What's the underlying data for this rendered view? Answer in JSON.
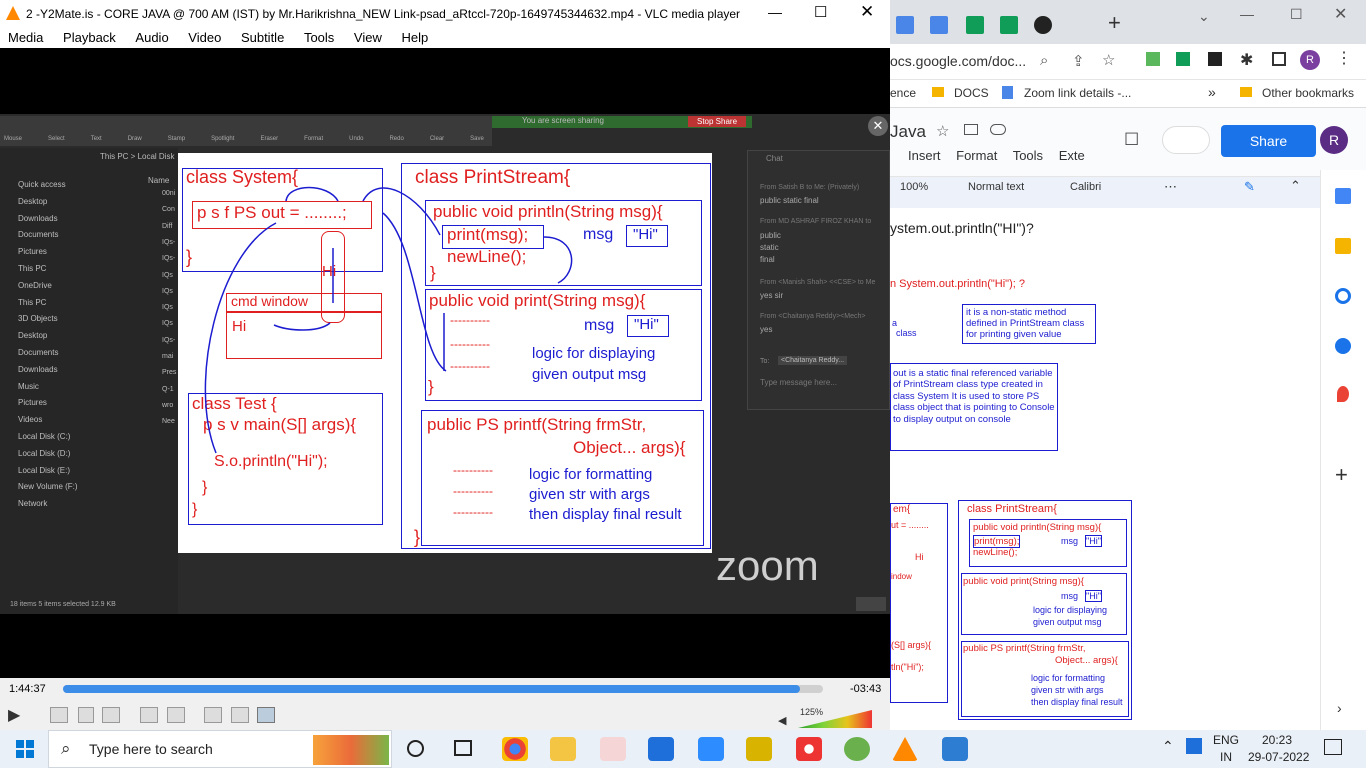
{
  "vlc": {
    "title": "2 -Y2Mate.is - CORE JAVA @ 700 AM (IST) by Mr.Harikrishna_NEW Link-psad_aRtccl-720p-1649745344632.mp4 - VLC media player",
    "menu": [
      "Media",
      "Playback",
      "Audio",
      "Video",
      "Subtitle",
      "Tools",
      "View",
      "Help"
    ],
    "time_elapsed": "1:44:37",
    "time_remaining": "-03:43",
    "progress": 0.97,
    "volume": "125%"
  },
  "zoom": {
    "sharing_text": "You are screen sharing",
    "stop_share": "Stop Share",
    "toolbar": [
      "Mouse",
      "Select",
      "Text",
      "Draw",
      "Stamp",
      "Spotlight",
      "Eraser",
      "Format",
      "Undo",
      "Redo",
      "Clear",
      "Save"
    ],
    "logo": "zoom"
  },
  "explorer": {
    "path": "This PC  >  Local Disk",
    "column": "Name",
    "items": [
      "Quick access",
      "Desktop",
      "Downloads",
      "Documents",
      "Pictures",
      "This PC",
      "OneDrive",
      "This PC",
      "3D Objects",
      "Desktop",
      "Documents",
      "Downloads",
      "Music",
      "Pictures",
      "Videos",
      "Local Disk (C:)",
      "Local Disk (D:)",
      "Local Disk (E:)",
      "New Volume (F:)",
      "Network"
    ],
    "files": [
      "00ni",
      "Con",
      "Diff",
      "IQs-",
      "IQs-",
      "IQs",
      "IQs",
      "IQs",
      "IQs",
      "IQs-",
      "mai",
      "Pres",
      "Q-1",
      "wro",
      "Nee"
    ],
    "status": "18 items      5 items selected  12.9 KB"
  },
  "chat": {
    "title": "Chat",
    "messages": [
      {
        "from": "From Satish B to Me: (Privately)",
        "text": "public static final"
      },
      {
        "from": "From MD ASHRAF FIROZ KHAN to",
        "text": "public\nstatic\nfinal"
      },
      {
        "from": "From <Manish Shah> <<CSE> to Me",
        "text": "yes sir"
      },
      {
        "from": "From <Chaitanya Reddy><Mech>",
        "text": "yes"
      }
    ],
    "to_label": "To:",
    "to_value": "<Chaitanya Reddy...",
    "input_placeholder": "Type message here..."
  },
  "whiteboard": {
    "system_class": "class System{",
    "psf": "p s f PS out = ........;",
    "hi": "Hi",
    "cmd": "cmd window",
    "cmd_hi": "Hi",
    "test_class": "class Test {",
    "main": "p s v main(S[] args){",
    "sop": "S.o.println(\"Hi\");",
    "close1": "}",
    "close2": "}",
    "close3": "}",
    "ps_class": "class PrintStream{",
    "println": "public void println(String msg){",
    "printcall": "print(msg);",
    "msg1": "msg",
    "hi_str1": "\"Hi\"",
    "newline": "newLine();",
    "pclose1": "}",
    "print": "public void print(String msg){",
    "msg2": "msg",
    "hi_str2": "\"Hi\"",
    "dash": "----------",
    "logic1": "logic for displaying",
    "logic2": "given output msg",
    "pclose2": "}",
    "printf1": "public PS printf(String  frmStr,",
    "printf2": "Object... args){",
    "fmt1": "logic for formatting",
    "fmt2": "given str with args",
    "fmt3": "then display final result",
    "pclose3": "}"
  },
  "chrome": {
    "address": "ocs.google.com/doc...",
    "bookmarks": [
      "ence",
      "DOCS",
      "Zoom link details -...",
      "Other bookmarks"
    ],
    "doc_title": "Java",
    "menu": [
      "Insert",
      "Format",
      "Tools",
      "Exte"
    ],
    "zoom": "100%",
    "style": "Normal text",
    "font": "Calibri",
    "share": "Share",
    "avatar": "R",
    "doc_line": "ystem.out.println(\"HI\")?",
    "doc_q": "n System.out.println(\"Hi\"); ?",
    "note1": "it is a non-static method defined in PrintStream class for printing given value",
    "note_a": "a",
    "note_class": "class",
    "note2": "out is a static final referenced variable of PrintStream class type created in class System It is used to store PS class object that is pointing to Console to display output on console",
    "mini": {
      "ps_class": "class PrintStream{",
      "println": "public void println(String msg){",
      "printcall": "print(msg);",
      "msg": "msg",
      "hi": "\"Hi\"",
      "newline": "newLine();",
      "print": "public void print(String msg){",
      "msg2": "msg",
      "hi2": "\"Hi\"",
      "logic1": "logic for displaying",
      "logic2": "given output msg",
      "printf1": "public PS printf(String  frmStr,",
      "printf2": "Object... args){",
      "fmt1": "logic for formatting",
      "fmt2": "given str with args",
      "fmt3": "then display final result",
      "left1": "em{",
      "left2": "ut = ........",
      "left3": "Hi",
      "left4": "indow",
      "left5": "(S[] args){",
      "left6": "tln(\"Hi\");"
    }
  },
  "taskbar": {
    "search": "Type here to search",
    "lang1": "ENG",
    "lang2": "IN",
    "time": "20:23",
    "date": "29-07-2022"
  }
}
